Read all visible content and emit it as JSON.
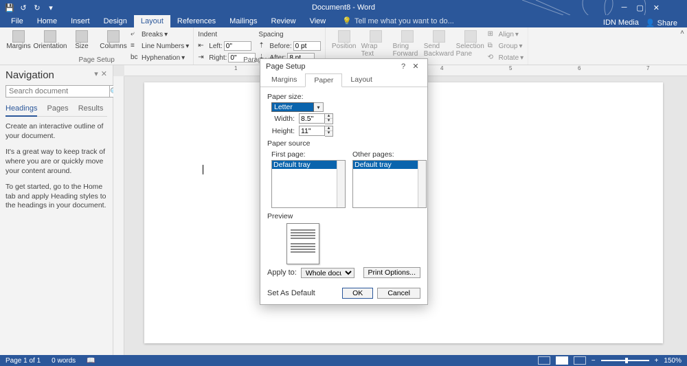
{
  "titlebar": {
    "title": "Document8 - Word",
    "idn": "IDN Media",
    "share": "Share"
  },
  "tabs": {
    "file": "File",
    "home": "Home",
    "insert": "Insert",
    "design": "Design",
    "layout": "Layout",
    "references": "References",
    "mailings": "Mailings",
    "review": "Review",
    "view": "View",
    "tell": "Tell me what you want to do..."
  },
  "ribbon": {
    "page_setup": {
      "margins": "Margins",
      "orientation": "Orientation",
      "size": "Size",
      "columns": "Columns",
      "breaks": "Breaks",
      "line_numbers": "Line Numbers",
      "hyphenation": "Hyphenation",
      "group": "Page Setup"
    },
    "paragraph": {
      "indent_hdr": "Indent",
      "spacing_hdr": "Spacing",
      "left": "Left:",
      "right": "Right:",
      "before": "Before:",
      "after": "After:",
      "left_v": "0\"",
      "right_v": "0\"",
      "before_v": "0 pt",
      "after_v": "8 pt",
      "group": "Paragraph"
    },
    "arrange": {
      "position": "Position",
      "wrap": "Wrap Text",
      "bring": "Bring Forward",
      "send": "Send Backward",
      "selection": "Selection Pane",
      "align": "Align",
      "group_btn": "Group",
      "rotate": "Rotate"
    }
  },
  "nav": {
    "title": "Navigation",
    "placeholder": "Search document",
    "tabs": {
      "headings": "Headings",
      "pages": "Pages",
      "results": "Results"
    },
    "p1": "Create an interactive outline of your document.",
    "p2": "It's a great way to keep track of where you are or quickly move your content around.",
    "p3": "To get started, go to the Home tab and apply Heading styles to the headings in your document."
  },
  "status": {
    "page": "Page 1 of 1",
    "words": "0 words",
    "zoom": "150%"
  },
  "dialog": {
    "title": "Page Setup",
    "tabs": {
      "margins": "Margins",
      "paper": "Paper",
      "layout": "Layout"
    },
    "paper_size_lbl": "Paper size:",
    "paper_size_val": "Letter",
    "width_lbl": "Width:",
    "width_val": "8.5\"",
    "height_lbl": "Height:",
    "height_val": "11\"",
    "paper_source_lbl": "Paper source",
    "first_page_lbl": "First page:",
    "other_pages_lbl": "Other pages:",
    "tray": "Default tray",
    "preview_lbl": "Preview",
    "apply_to_lbl": "Apply to:",
    "apply_to_val": "Whole document",
    "print_options": "Print Options...",
    "set_default": "Set As Default",
    "ok": "OK",
    "cancel": "Cancel"
  }
}
